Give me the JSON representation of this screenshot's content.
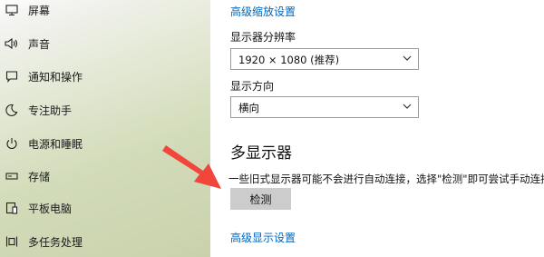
{
  "sidebar": {
    "items": [
      {
        "label": "屏幕",
        "icon": "display-icon"
      },
      {
        "label": "声音",
        "icon": "speaker-icon"
      },
      {
        "label": "通知和操作",
        "icon": "notification-icon"
      },
      {
        "label": "专注助手",
        "icon": "moon-icon"
      },
      {
        "label": "电源和睡眠",
        "icon": "power-icon"
      },
      {
        "label": "存储",
        "icon": "storage-icon"
      },
      {
        "label": "平板电脑",
        "icon": "tablet-icon"
      },
      {
        "label": "多任务处理",
        "icon": "multitasking-icon"
      }
    ]
  },
  "main": {
    "advanced_scaling_link": "高级缩放设置",
    "resolution": {
      "label": "显示器分辨率",
      "value": "1920 × 1080 (推荐)"
    },
    "orientation": {
      "label": "显示方向",
      "value": "横向"
    },
    "multi_display": {
      "heading": "多显示器",
      "description": "一些旧式显示器可能不会进行自动连接，选择\"检测\"即可尝试手动连接。",
      "detect_button": "检测",
      "advanced_display_link": "高级显示设置"
    }
  },
  "colors": {
    "link": "#0067c0",
    "arrow": "#f0463c",
    "button": "#cccccc"
  }
}
